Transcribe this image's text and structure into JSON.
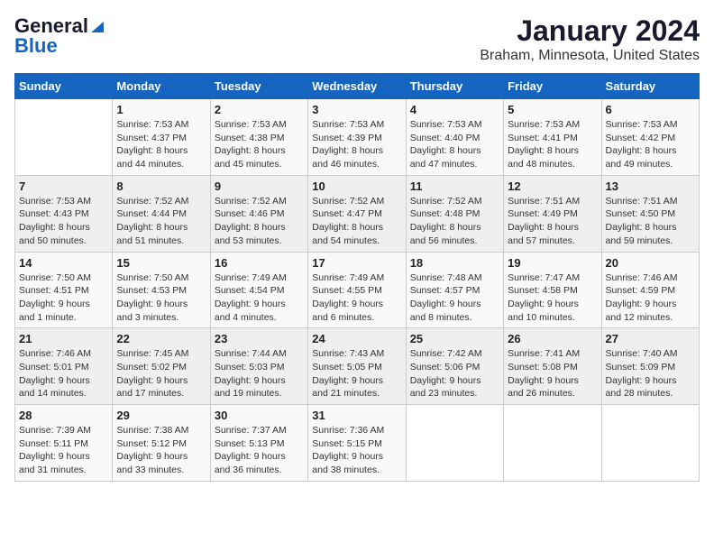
{
  "header": {
    "logo_general": "General",
    "logo_blue": "Blue",
    "title": "January 2024",
    "subtitle": "Braham, Minnesota, United States"
  },
  "weekdays": [
    "Sunday",
    "Monday",
    "Tuesday",
    "Wednesday",
    "Thursday",
    "Friday",
    "Saturday"
  ],
  "weeks": [
    [
      {
        "day": "",
        "info": ""
      },
      {
        "day": "1",
        "info": "Sunrise: 7:53 AM\nSunset: 4:37 PM\nDaylight: 8 hours\nand 44 minutes."
      },
      {
        "day": "2",
        "info": "Sunrise: 7:53 AM\nSunset: 4:38 PM\nDaylight: 8 hours\nand 45 minutes."
      },
      {
        "day": "3",
        "info": "Sunrise: 7:53 AM\nSunset: 4:39 PM\nDaylight: 8 hours\nand 46 minutes."
      },
      {
        "day": "4",
        "info": "Sunrise: 7:53 AM\nSunset: 4:40 PM\nDaylight: 8 hours\nand 47 minutes."
      },
      {
        "day": "5",
        "info": "Sunrise: 7:53 AM\nSunset: 4:41 PM\nDaylight: 8 hours\nand 48 minutes."
      },
      {
        "day": "6",
        "info": "Sunrise: 7:53 AM\nSunset: 4:42 PM\nDaylight: 8 hours\nand 49 minutes."
      }
    ],
    [
      {
        "day": "7",
        "info": "Sunrise: 7:53 AM\nSunset: 4:43 PM\nDaylight: 8 hours\nand 50 minutes."
      },
      {
        "day": "8",
        "info": "Sunrise: 7:52 AM\nSunset: 4:44 PM\nDaylight: 8 hours\nand 51 minutes."
      },
      {
        "day": "9",
        "info": "Sunrise: 7:52 AM\nSunset: 4:46 PM\nDaylight: 8 hours\nand 53 minutes."
      },
      {
        "day": "10",
        "info": "Sunrise: 7:52 AM\nSunset: 4:47 PM\nDaylight: 8 hours\nand 54 minutes."
      },
      {
        "day": "11",
        "info": "Sunrise: 7:52 AM\nSunset: 4:48 PM\nDaylight: 8 hours\nand 56 minutes."
      },
      {
        "day": "12",
        "info": "Sunrise: 7:51 AM\nSunset: 4:49 PM\nDaylight: 8 hours\nand 57 minutes."
      },
      {
        "day": "13",
        "info": "Sunrise: 7:51 AM\nSunset: 4:50 PM\nDaylight: 8 hours\nand 59 minutes."
      }
    ],
    [
      {
        "day": "14",
        "info": "Sunrise: 7:50 AM\nSunset: 4:51 PM\nDaylight: 9 hours\nand 1 minute."
      },
      {
        "day": "15",
        "info": "Sunrise: 7:50 AM\nSunset: 4:53 PM\nDaylight: 9 hours\nand 3 minutes."
      },
      {
        "day": "16",
        "info": "Sunrise: 7:49 AM\nSunset: 4:54 PM\nDaylight: 9 hours\nand 4 minutes."
      },
      {
        "day": "17",
        "info": "Sunrise: 7:49 AM\nSunset: 4:55 PM\nDaylight: 9 hours\nand 6 minutes."
      },
      {
        "day": "18",
        "info": "Sunrise: 7:48 AM\nSunset: 4:57 PM\nDaylight: 9 hours\nand 8 minutes."
      },
      {
        "day": "19",
        "info": "Sunrise: 7:47 AM\nSunset: 4:58 PM\nDaylight: 9 hours\nand 10 minutes."
      },
      {
        "day": "20",
        "info": "Sunrise: 7:46 AM\nSunset: 4:59 PM\nDaylight: 9 hours\nand 12 minutes."
      }
    ],
    [
      {
        "day": "21",
        "info": "Sunrise: 7:46 AM\nSunset: 5:01 PM\nDaylight: 9 hours\nand 14 minutes."
      },
      {
        "day": "22",
        "info": "Sunrise: 7:45 AM\nSunset: 5:02 PM\nDaylight: 9 hours\nand 17 minutes."
      },
      {
        "day": "23",
        "info": "Sunrise: 7:44 AM\nSunset: 5:03 PM\nDaylight: 9 hours\nand 19 minutes."
      },
      {
        "day": "24",
        "info": "Sunrise: 7:43 AM\nSunset: 5:05 PM\nDaylight: 9 hours\nand 21 minutes."
      },
      {
        "day": "25",
        "info": "Sunrise: 7:42 AM\nSunset: 5:06 PM\nDaylight: 9 hours\nand 23 minutes."
      },
      {
        "day": "26",
        "info": "Sunrise: 7:41 AM\nSunset: 5:08 PM\nDaylight: 9 hours\nand 26 minutes."
      },
      {
        "day": "27",
        "info": "Sunrise: 7:40 AM\nSunset: 5:09 PM\nDaylight: 9 hours\nand 28 minutes."
      }
    ],
    [
      {
        "day": "28",
        "info": "Sunrise: 7:39 AM\nSunset: 5:11 PM\nDaylight: 9 hours\nand 31 minutes."
      },
      {
        "day": "29",
        "info": "Sunrise: 7:38 AM\nSunset: 5:12 PM\nDaylight: 9 hours\nand 33 minutes."
      },
      {
        "day": "30",
        "info": "Sunrise: 7:37 AM\nSunset: 5:13 PM\nDaylight: 9 hours\nand 36 minutes."
      },
      {
        "day": "31",
        "info": "Sunrise: 7:36 AM\nSunset: 5:15 PM\nDaylight: 9 hours\nand 38 minutes."
      },
      {
        "day": "",
        "info": ""
      },
      {
        "day": "",
        "info": ""
      },
      {
        "day": "",
        "info": ""
      }
    ]
  ]
}
